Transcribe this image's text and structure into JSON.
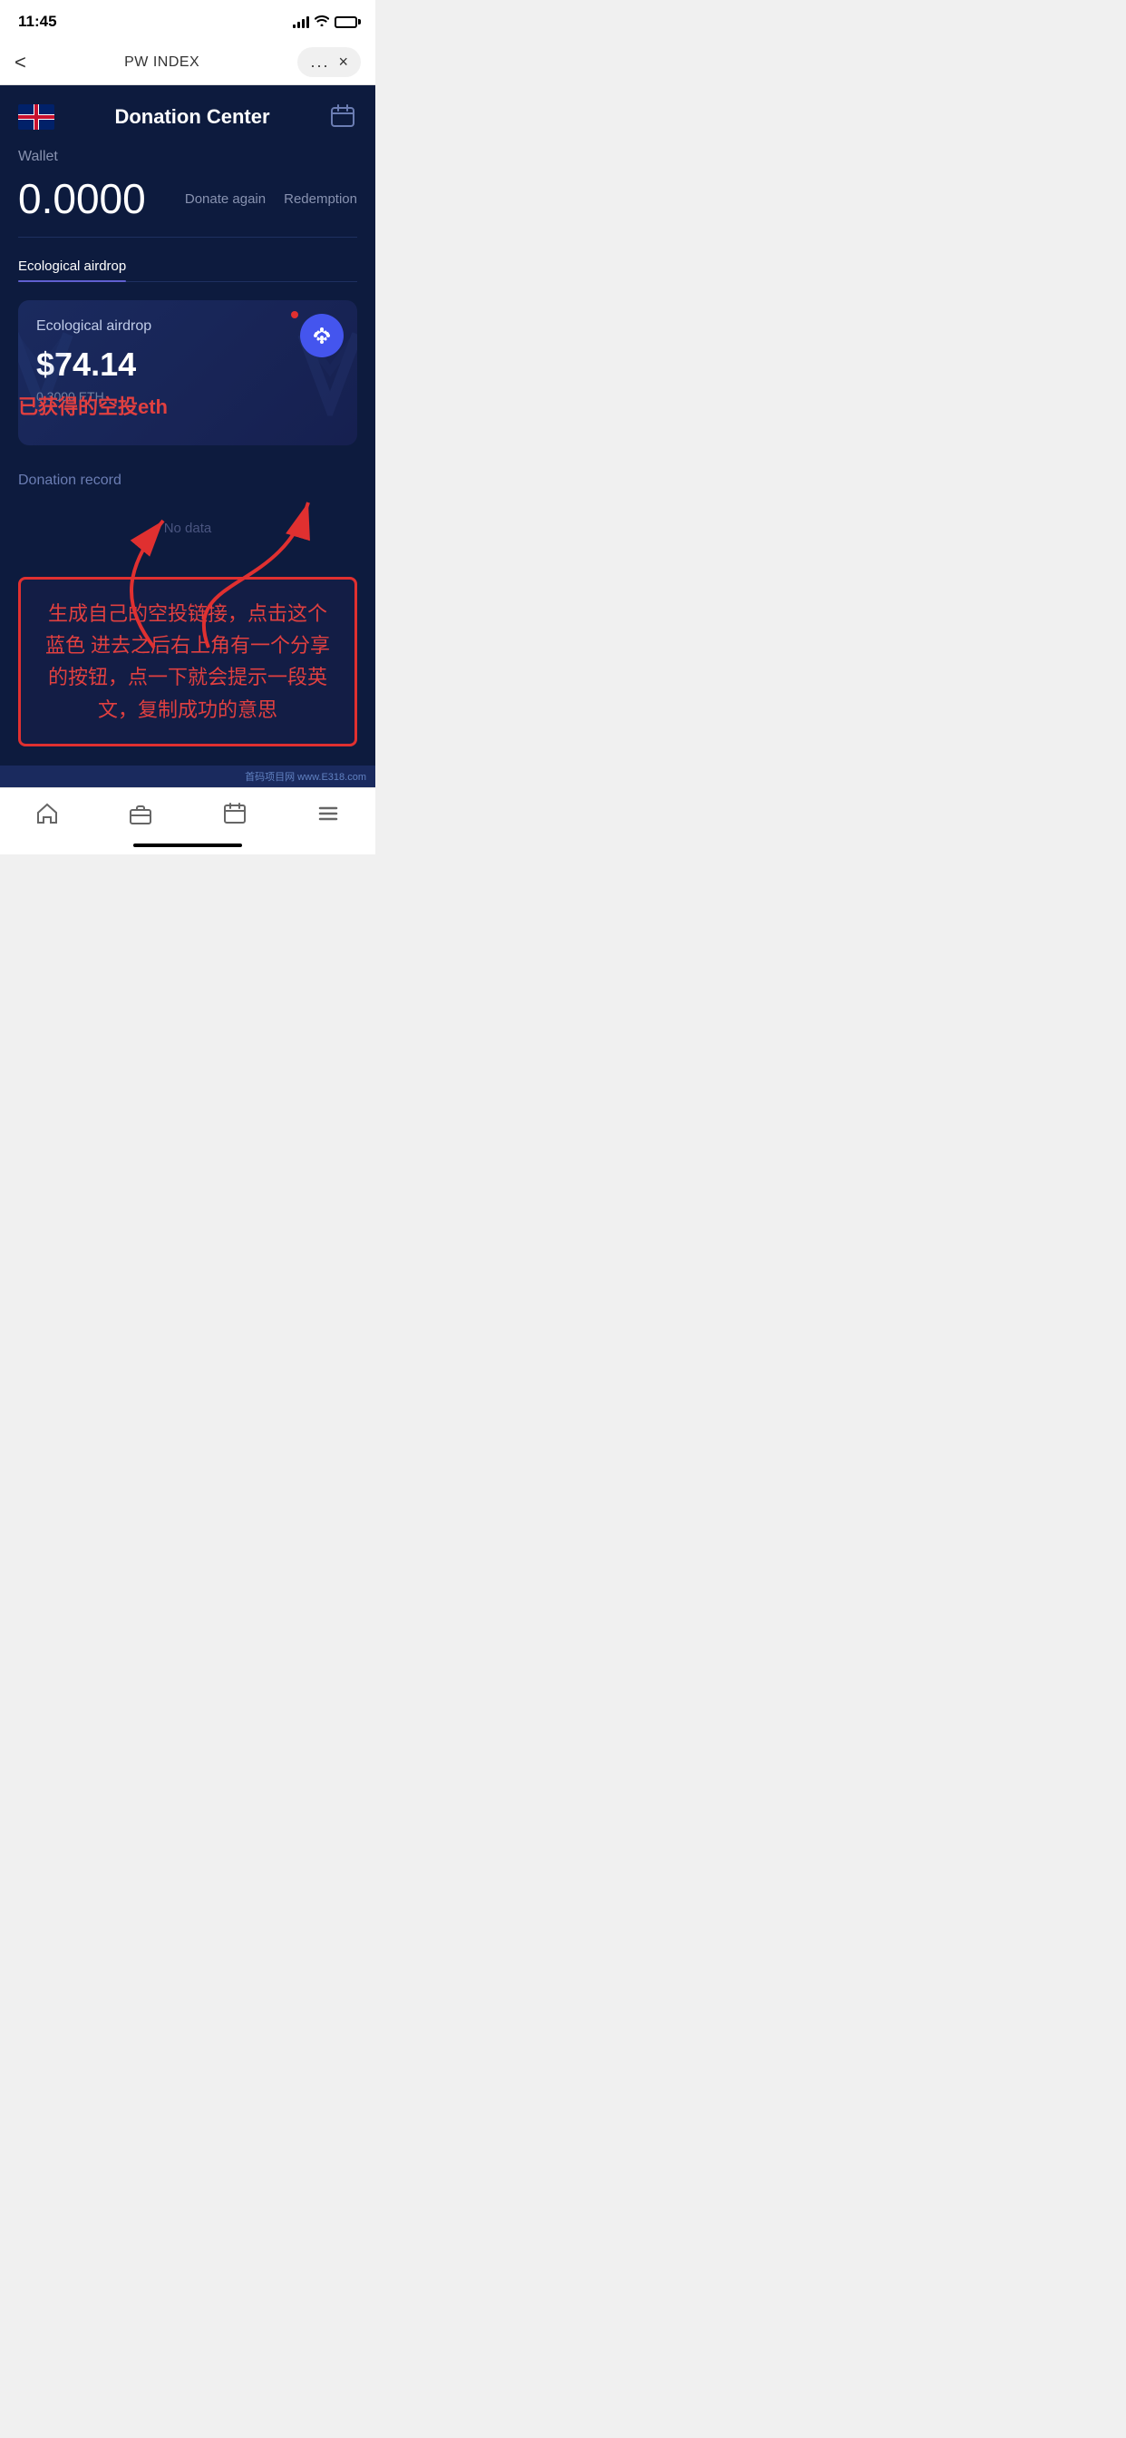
{
  "statusBar": {
    "time": "11:45"
  },
  "browserBar": {
    "title": "PW INDEX",
    "back": "<",
    "dots": "...",
    "close": "×"
  },
  "header": {
    "title": "Donation Center"
  },
  "wallet": {
    "label": "Wallet",
    "amount": "0.0000",
    "donateAgain": "Donate again",
    "redemption": "Redemption"
  },
  "tabs": [
    {
      "label": "Ecological airdrop",
      "active": true
    },
    {
      "label": "",
      "active": false
    }
  ],
  "airdropCard": {
    "label": "Ecological airdrop",
    "amountUSD": "$74.14",
    "amountETH": "0.3000 ETH"
  },
  "donationRecord": {
    "label": "Donation record",
    "noData": "No data"
  },
  "annotation": {
    "overlayText": "已获得的空投eth",
    "boxText": "生成自己的空投链接，点击这个蓝色 进去之后右上角有一个分享的按钮，点一下就会提示一段英文，复制成功的意思"
  },
  "bottomNav": {
    "items": [
      "home",
      "briefcase",
      "calendar",
      "menu"
    ]
  },
  "website": {
    "label": "首码项目网 www.E318.com"
  }
}
